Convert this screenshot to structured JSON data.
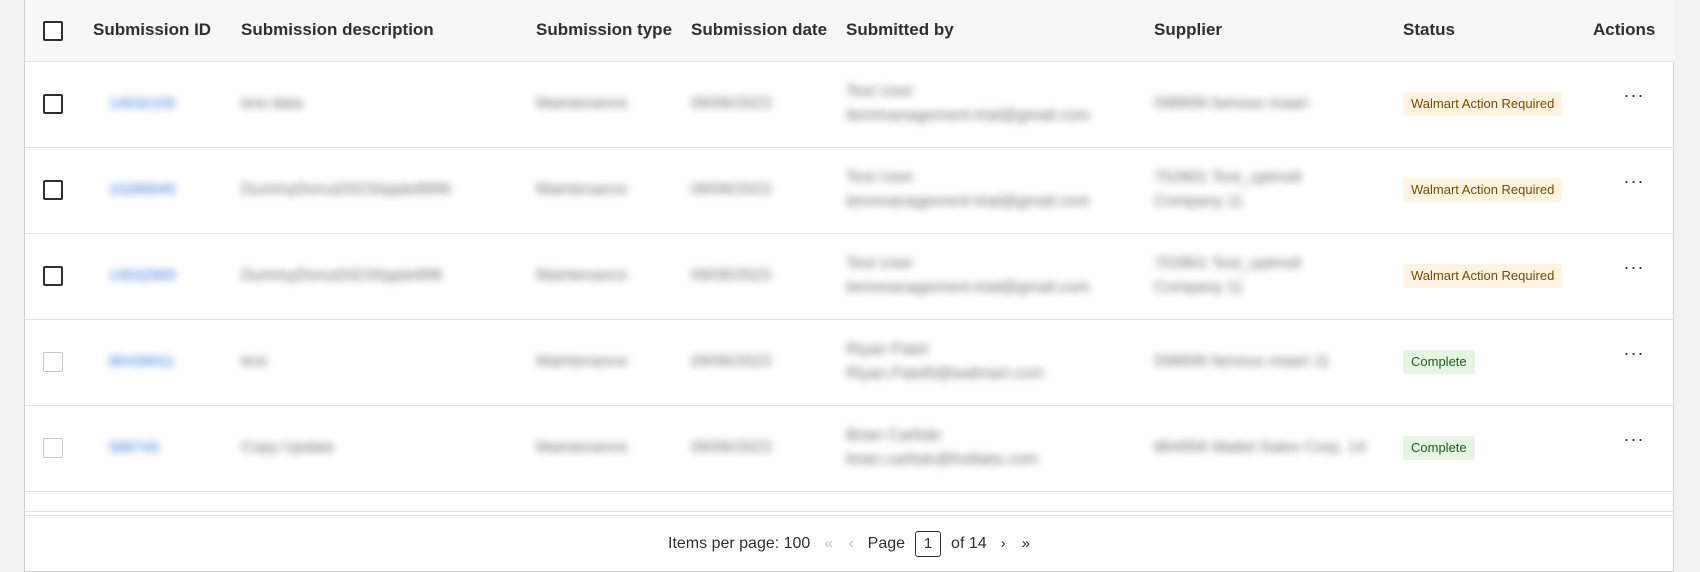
{
  "table": {
    "headers": {
      "submission_id": "Submission ID",
      "description": "Submission description",
      "type": "Submission type",
      "date": "Submission date",
      "submitted_by": "Submitted by",
      "supplier": "Supplier",
      "status": "Status",
      "actions": "Actions"
    },
    "rows": [
      {
        "id": "14532155",
        "description": "test data",
        "type": "Maintenance",
        "date": "09/06/2023",
        "name": "Test User",
        "email": "itemmanagement-trial@gmail.com",
        "supplier_line1": "598699 famous maari",
        "supplier_line2": "",
        "status": "Walmart Action Required",
        "status_kind": "warn",
        "checkbox_disabled": false
      },
      {
        "id": "15289045",
        "description": "DummyDonut2023Apple8996",
        "type": "Maintenance",
        "date": "09/06/2023",
        "name": "Test User",
        "email": "itemmanagement-trial@gmail.com",
        "supplier_line1": "752801 Test_uptmslt",
        "supplier_line2": "Company 11",
        "status": "Walmart Action Required",
        "status_kind": "warn",
        "checkbox_disabled": false
      },
      {
        "id": "14532909",
        "description": "DummyDonut2023Apple898",
        "type": "Maintenance",
        "date": "09/06/2023",
        "name": "Test User",
        "email": "itemmanagement-trial@gmail.com",
        "supplier_line1": "752801 Test_uptmslt",
        "supplier_line2": "Company 11",
        "status": "Walmart Action Required",
        "status_kind": "warn",
        "checkbox_disabled": false
      },
      {
        "id": "85439911",
        "description": "test",
        "type": "Maintenance",
        "date": "09/06/2023",
        "name": "Riyan Patel",
        "email": "Riyan.Patel0@walmart.com",
        "supplier_line1": "598699 famous maari 11",
        "supplier_line2": "",
        "status": "Complete",
        "status_kind": "ok",
        "checkbox_disabled": true
      },
      {
        "id": "589745",
        "description": "Copy Update",
        "type": "Maintenance",
        "date": "09/06/2023",
        "name": "Brian Carlisle",
        "email": "brian.carlisle@hotlabs.com",
        "supplier_line1": "864956 Mattel Sales Corp. 14",
        "supplier_line2": "",
        "status": "Complete",
        "status_kind": "ok",
        "checkbox_disabled": true
      }
    ],
    "actions_glyph": "···"
  },
  "pager": {
    "items_per_page_label": "Items per page: 100",
    "page_label": "Page",
    "current_page": "1",
    "of_label": "of 14",
    "first_glyph": "«",
    "prev_glyph": "‹",
    "next_glyph": "›",
    "last_glyph": "»"
  }
}
